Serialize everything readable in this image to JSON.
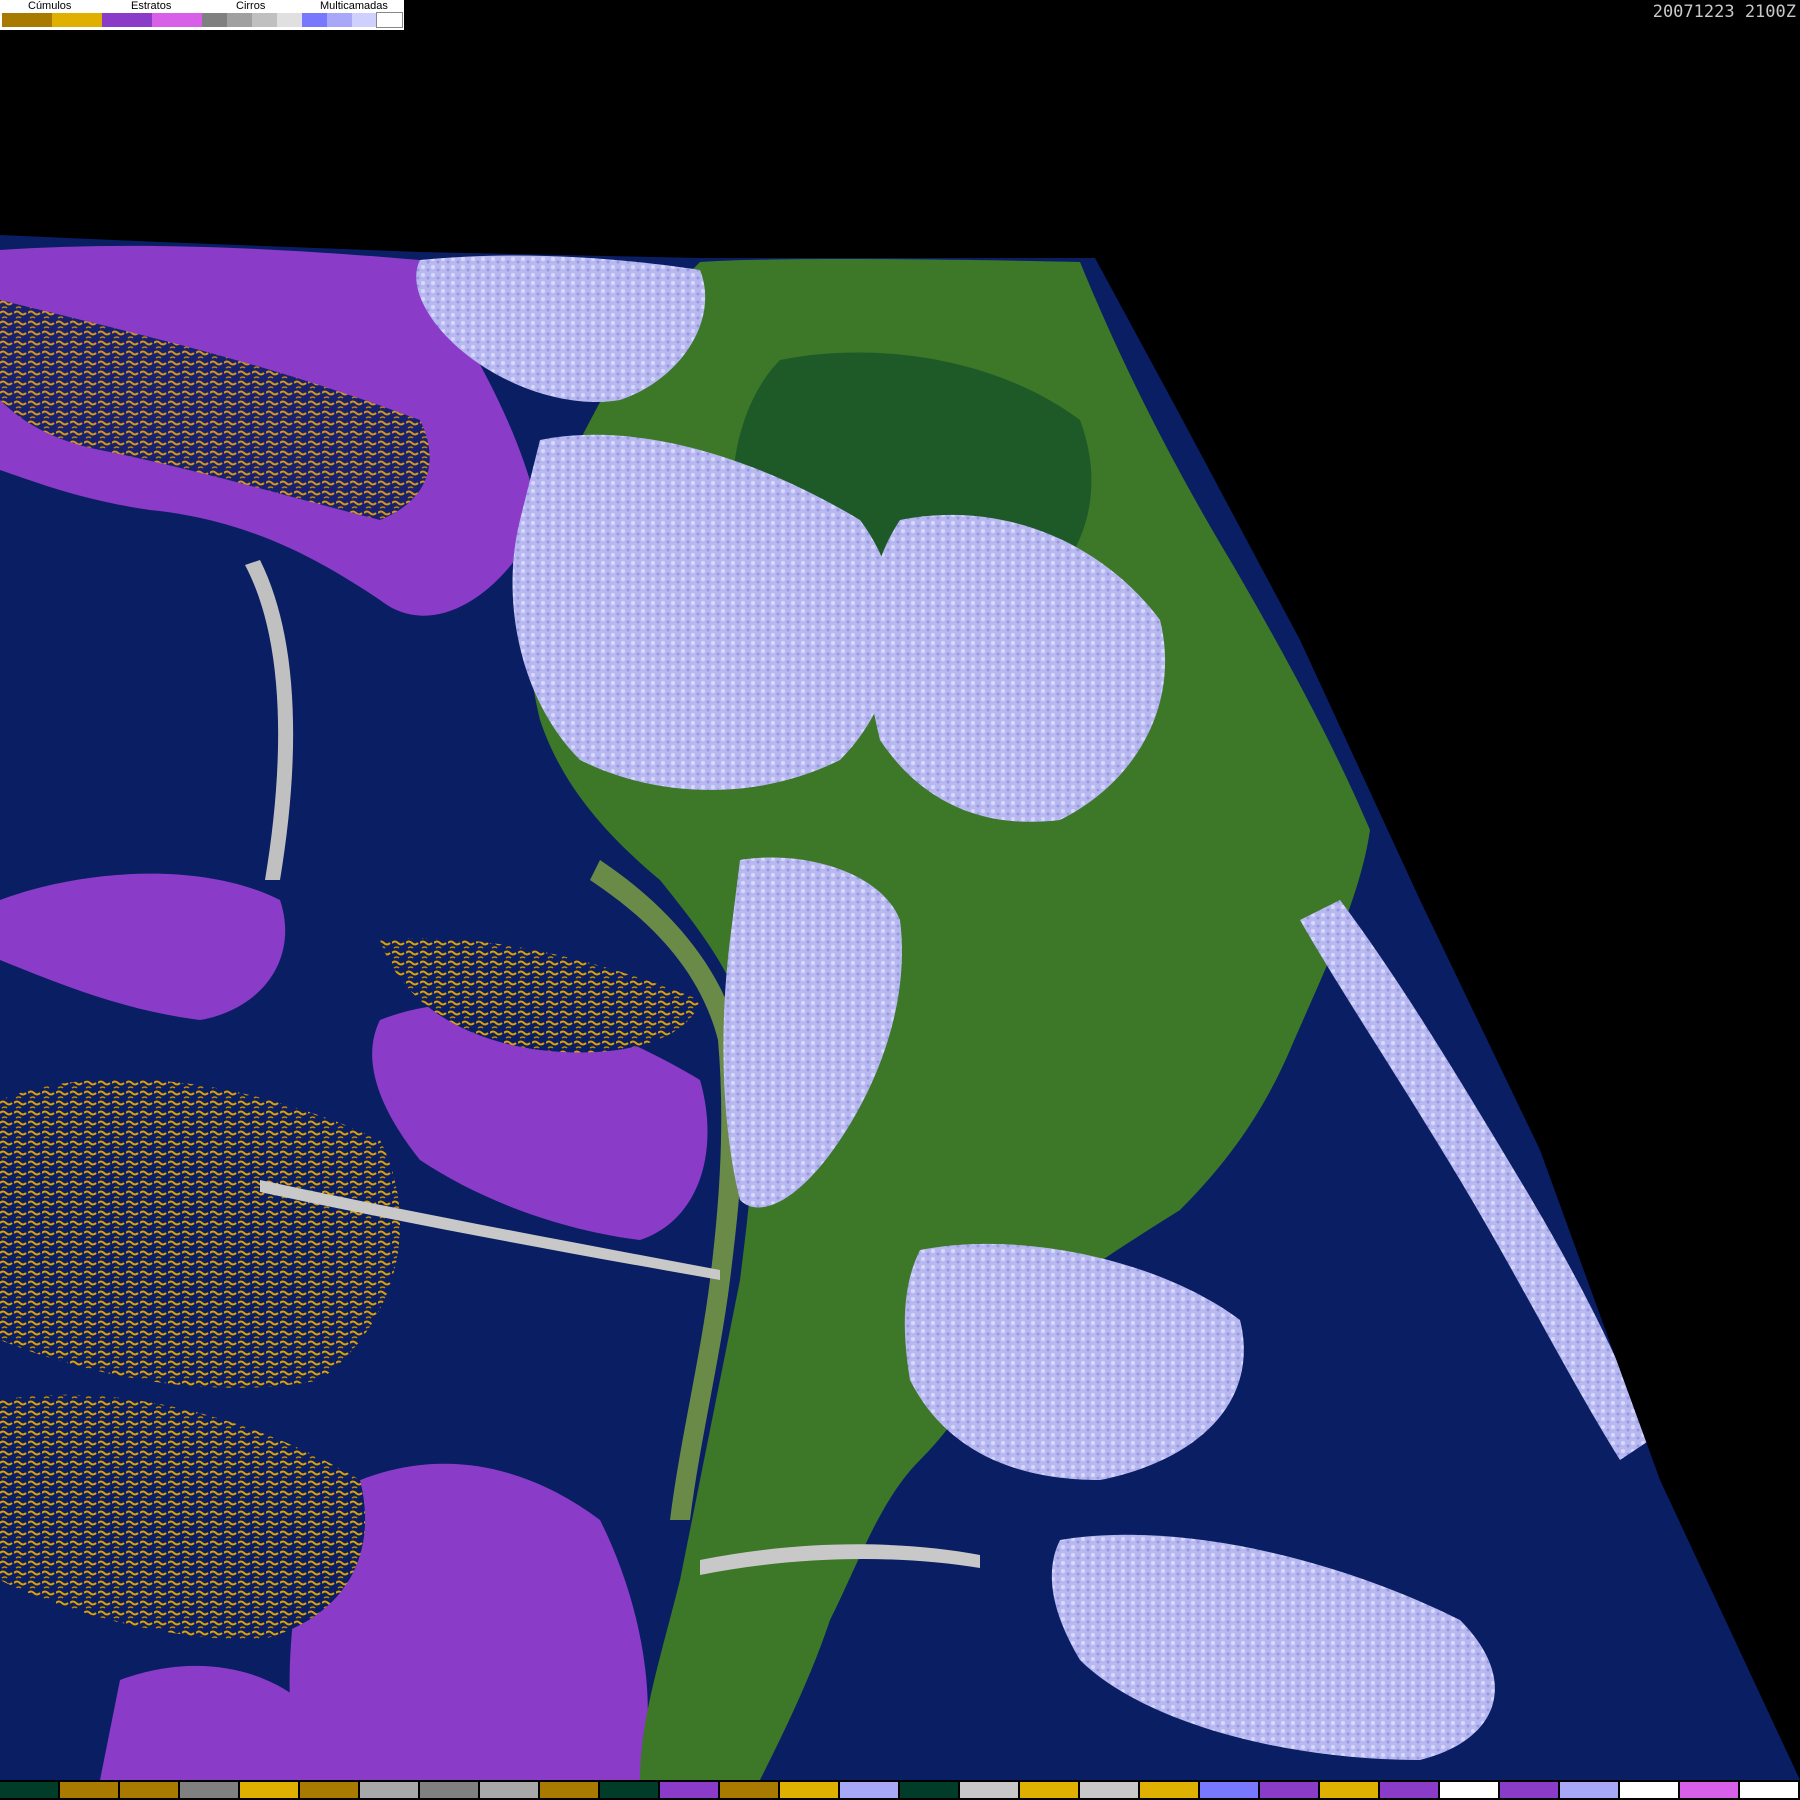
{
  "legend": {
    "groups": [
      {
        "label": "Cúmulos",
        "colors": [
          "#a87a00",
          "#e0b000"
        ]
      },
      {
        "label": "Estratos",
        "colors": [
          "#8a3cc8",
          "#d860e8"
        ]
      },
      {
        "label": "Cirros",
        "colors": [
          "#808080",
          "#a0a0a0",
          "#c0c0c0",
          "#e0e0e0"
        ]
      },
      {
        "label": "Multicamadas",
        "colors": [
          "#7878ff",
          "#a8a8f8",
          "#d0d0ff",
          "#ffffff"
        ]
      }
    ]
  },
  "timestamp": "20071223 2100Z",
  "colors": {
    "background": "#000000",
    "ocean": "#0a1e64",
    "land": "#3c7828",
    "land_dark": "#1e5028",
    "cumulus": "#e0a000",
    "stratus": "#8a3cc8",
    "cirrus": "#a8a8a8",
    "multilayer": "#c8c8ff"
  },
  "bottom_bar_colors": [
    "#003c28",
    "#a87a00",
    "#a87a00",
    "#808080",
    "#e0b000",
    "#a87a00",
    "#a8a8a8",
    "#808080",
    "#a8a8a8",
    "#a87a00",
    "#003c28",
    "#8a3cc8",
    "#a87a00",
    "#e0b000",
    "#a8a8f8",
    "#003c28",
    "#c8c8c8",
    "#e0b000",
    "#c8c8c8",
    "#e0b000",
    "#7878ff",
    "#8a3cc8",
    "#e0b000",
    "#8a3cc8",
    "#ffffff",
    "#8a3cc8",
    "#a8a8f8",
    "#ffffff",
    "#d860e8",
    "#ffffff"
  ]
}
